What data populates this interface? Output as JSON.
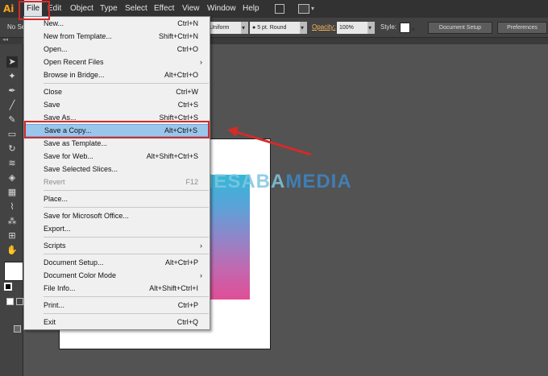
{
  "app": {
    "logo": "Ai"
  },
  "menubar": {
    "items": [
      "File",
      "Edit",
      "Object",
      "Type",
      "Select",
      "Effect",
      "View",
      "Window",
      "Help"
    ]
  },
  "controlbar": {
    "left_text": "No Se",
    "stroke_profile": "Uniform",
    "brush": "5 pt. Round",
    "opacity_label": "Opacity:",
    "opacity_value": "100%",
    "style_label": "Style:",
    "document_setup": "Document Setup",
    "preferences": "Preferences"
  },
  "file_menu": {
    "items": [
      {
        "label": "New...",
        "shortcut": "Ctrl+N"
      },
      {
        "label": "New from Template...",
        "shortcut": "Shift+Ctrl+N"
      },
      {
        "label": "Open...",
        "shortcut": "Ctrl+O"
      },
      {
        "label": "Open Recent Files",
        "shortcut": ""
      },
      {
        "label": "Browse in Bridge...",
        "shortcut": "Alt+Ctrl+O"
      },
      {
        "label": "Close",
        "shortcut": "Ctrl+W"
      },
      {
        "label": "Save",
        "shortcut": "Ctrl+S"
      },
      {
        "label": "Save As...",
        "shortcut": "Shift+Ctrl+S"
      },
      {
        "label": "Save a Copy...",
        "shortcut": "Alt+Ctrl+S"
      },
      {
        "label": "Save as Template...",
        "shortcut": ""
      },
      {
        "label": "Save for Web...",
        "shortcut": "Alt+Shift+Ctrl+S"
      },
      {
        "label": "Save Selected Slices...",
        "shortcut": ""
      },
      {
        "label": "Revert",
        "shortcut": "F12"
      },
      {
        "label": "Place...",
        "shortcut": ""
      },
      {
        "label": "Save for Microsoft Office...",
        "shortcut": ""
      },
      {
        "label": "Export...",
        "shortcut": ""
      },
      {
        "label": "Scripts",
        "shortcut": ""
      },
      {
        "label": "Document Setup...",
        "shortcut": "Alt+Ctrl+P"
      },
      {
        "label": "Document Color Mode",
        "shortcut": ""
      },
      {
        "label": "File Info...",
        "shortcut": "Alt+Shift+Ctrl+I"
      },
      {
        "label": "Print...",
        "shortcut": "Ctrl+P"
      },
      {
        "label": "Exit",
        "shortcut": "Ctrl+Q"
      }
    ]
  },
  "watermark": {
    "part1": "NESABA",
    "part2": "MEDIA"
  },
  "colors": {
    "highlight": "#9bc6ec",
    "annotation": "#d42a2a",
    "logo": "#f7a21b"
  }
}
